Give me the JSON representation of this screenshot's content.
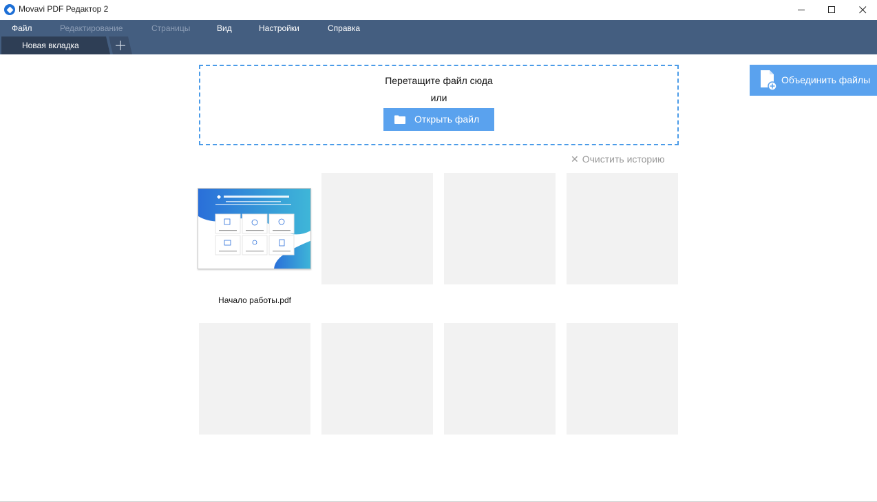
{
  "window": {
    "title": "Movavi PDF Редактор 2",
    "minimize_symbol": "—",
    "maximize_symbol": "☐",
    "close_symbol": "✕"
  },
  "menu": {
    "items": [
      {
        "label": "Файл",
        "enabled": true
      },
      {
        "label": "Редактирование",
        "enabled": false
      },
      {
        "label": "Страницы",
        "enabled": false
      },
      {
        "label": "Вид",
        "enabled": true
      },
      {
        "label": "Настройки",
        "enabled": true
      },
      {
        "label": "Справка",
        "enabled": true
      }
    ]
  },
  "tabs": {
    "active_label": "Новая вкладка",
    "add_symbol": "+"
  },
  "dropzone": {
    "title": "Перетащите файл сюда",
    "or": "или",
    "open_button": "Открыть файл"
  },
  "merge_button": "Объединить файлы",
  "history": {
    "clear_label": "Очистить историю",
    "clear_symbol": "✕",
    "recent_files": [
      {
        "name": "Начало работы.pdf"
      }
    ],
    "empty_slots": 7
  },
  "colors": {
    "menubar": "#445e80",
    "accent": "#5aa2ee",
    "dropzone_border": "#4a9be8",
    "tile": "#f2f2f2"
  }
}
